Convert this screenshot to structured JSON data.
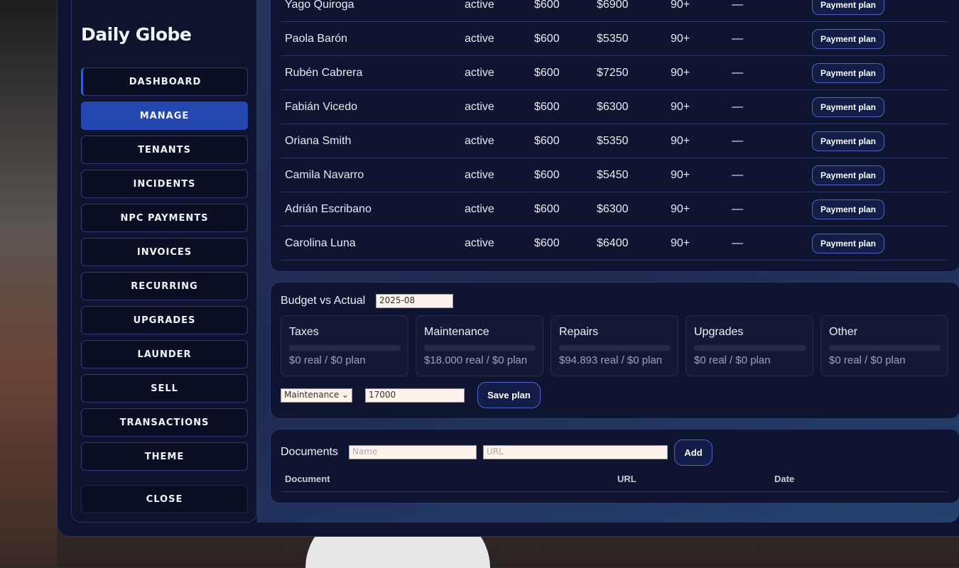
{
  "app": {
    "title": "Daily Globe"
  },
  "nav": [
    "DASHBOARD",
    "MANAGE",
    "TENANTS",
    "INCIDENTS",
    "NPC PAYMENTS",
    "INVOICES",
    "RECURRING",
    "UPGRADES",
    "LAUNDER",
    "SELL",
    "TRANSACTIONS",
    "THEME"
  ],
  "close_label": "CLOSE",
  "tenants": [
    {
      "name": "Yago Quiroga",
      "status": "active",
      "rent": "$600",
      "total": "$6900",
      "days": "90+",
      "note": "—",
      "action": "Payment plan"
    },
    {
      "name": "Paola Barón",
      "status": "active",
      "rent": "$600",
      "total": "$5350",
      "days": "90+",
      "note": "—",
      "action": "Payment plan"
    },
    {
      "name": "Rubén Cabrera",
      "status": "active",
      "rent": "$600",
      "total": "$7250",
      "days": "90+",
      "note": "—",
      "action": "Payment plan"
    },
    {
      "name": "Fabián Vicedo",
      "status": "active",
      "rent": "$600",
      "total": "$6300",
      "days": "90+",
      "note": "—",
      "action": "Payment plan"
    },
    {
      "name": "Oriana Smith",
      "status": "active",
      "rent": "$600",
      "total": "$5350",
      "days": "90+",
      "note": "—",
      "action": "Payment plan"
    },
    {
      "name": "Camila Navarro",
      "status": "active",
      "rent": "$600",
      "total": "$5450",
      "days": "90+",
      "note": "—",
      "action": "Payment plan"
    },
    {
      "name": "Adrián Escribano",
      "status": "active",
      "rent": "$600",
      "total": "$6300",
      "days": "90+",
      "note": "—",
      "action": "Payment plan"
    },
    {
      "name": "Carolina Luna",
      "status": "active",
      "rent": "$600",
      "total": "$6400",
      "days": "90+",
      "note": "—",
      "action": "Payment plan"
    }
  ],
  "budget": {
    "title": "Budget vs Actual",
    "month": "2025-08",
    "categories": [
      {
        "name": "Taxes",
        "value": "$0 real / $0 plan"
      },
      {
        "name": "Maintenance",
        "value": "$18.000 real / $0 plan"
      },
      {
        "name": "Repairs",
        "value": "$94.893 real / $0 plan"
      },
      {
        "name": "Upgrades",
        "value": "$0 real / $0 plan"
      },
      {
        "name": "Other",
        "value": "$0 real / $0 plan"
      }
    ],
    "selected_category": "Maintenance",
    "amount": "17000",
    "save_label": "Save plan"
  },
  "documents": {
    "title": "Documents",
    "name_placeholder": "Name",
    "url_placeholder": "URL",
    "add_label": "Add",
    "columns": [
      "Document",
      "URL",
      "Date"
    ]
  }
}
